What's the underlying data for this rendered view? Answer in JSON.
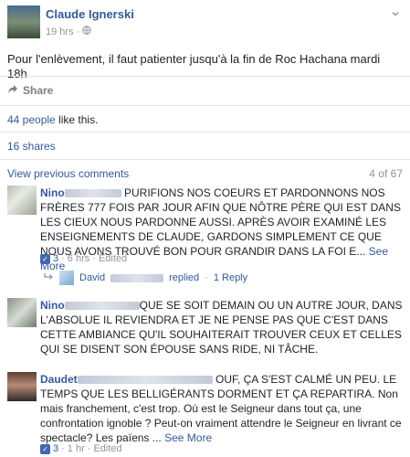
{
  "post": {
    "author": "Claude Ignerski",
    "time": "19 hrs",
    "privacy_icon": "globe-icon",
    "text": "Pour l'enlèvement, il faut patienter jusqu'à la fin de Roc Hachana mardi 18h",
    "share_label": "Share"
  },
  "stats": {
    "likes_link": "44 people",
    "likes_suffix": " like this.",
    "shares": "16 shares"
  },
  "comments_header": {
    "view_previous": "View previous comments",
    "count": "4 of 67"
  },
  "comments": [
    {
      "name": "Nino",
      "text": "PURIFIONS NOS COEURS ET PARDONNONS NOS FRÈRES 777 FOIS PAR JOUR AFIN QUE NÔTRE PÈRE QUI EST DANS LES CIEUX NOUS PARDONNE AUSSI. APRÈS AVOIR EXAMINÉ LES ENSEIGNEMENTS DE CLAUDE, GARDONS SIMPLEMENT CE QUE NOUS AVONS TROUVÉ BON POUR GRANDIR DANS LA FOI E...",
      "see_more": "See More",
      "likes": "3",
      "time": "6 hrs",
      "edited": "Edited",
      "reply": {
        "name": "David",
        "action": "replied",
        "count": "1 Reply"
      }
    },
    {
      "name": "Nino",
      "text": "QUE SE SOIT DEMAIN OU UN AUTRE JOUR, DANS L'ABSOLUE IL REVIENDRA ET JE NE PENSE PAS QUE C'EST DANS CETTE AMBIANCE QU'IL SOUHAITERAIT TROUVER CEUX ET CELLES QUI SE DISENT SON ÉPOUSE SANS RIDE, NI TÂCHE."
    },
    {
      "name": "Daudet",
      "text": "OUF, ÇA S'EST CALMÉ UN PEU. LE TEMPS QUE LES BELLIGÉRANTS DORMENT ET ÇA REPARTIRA. Non mais franchement, c'est trop. Où est le Seigneur dans tout ça, une confrontation ignoble ? Peut-on vraiment attendre le Seigneur en livrant ce spectacle? Les païens ...",
      "see_more": "See More",
      "likes": "3",
      "time": "1 hr",
      "edited": "Edited"
    }
  ]
}
